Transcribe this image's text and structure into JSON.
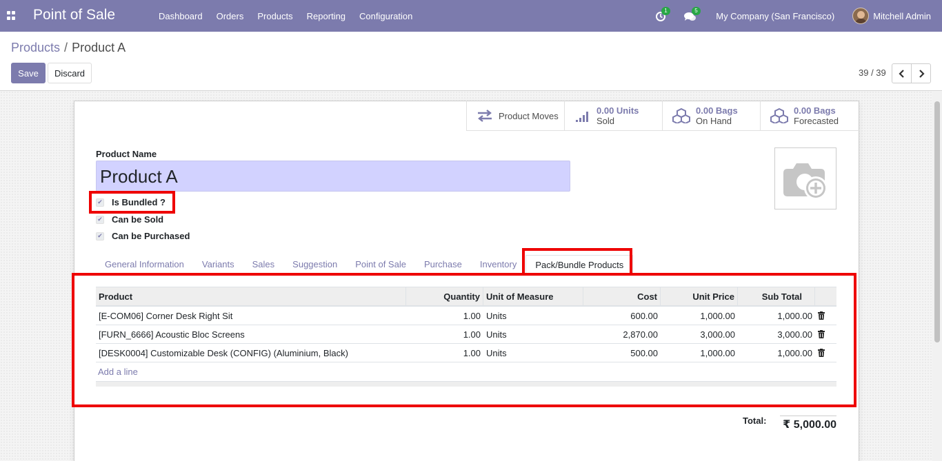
{
  "navbar": {
    "app_name": "Point of Sale",
    "menu": [
      "Dashboard",
      "Orders",
      "Products",
      "Reporting",
      "Configuration"
    ],
    "activity_badge": "1",
    "message_badge": "5",
    "company": "My Company (San Francisco)",
    "user": "Mitchell Admin",
    "bg_color": "#7c7bad"
  },
  "breadcrumb": {
    "parent": "Products",
    "separator": "/",
    "current": "Product A"
  },
  "buttons": {
    "save": "Save",
    "discard": "Discard"
  },
  "pager": {
    "value": "39 / 39"
  },
  "stats": {
    "moves": "Product Moves",
    "sold_value": "0.00 Units",
    "sold_label": "Sold",
    "onhand_value": "0.00 Bags",
    "onhand_label": "On Hand",
    "forecast_value": "0.00 Bags",
    "forecast_label": "Forecasted"
  },
  "form": {
    "name_label": "Product Name",
    "name_value": "Product A",
    "checkboxes": [
      {
        "label": "Is Bundled ?",
        "checked": true
      },
      {
        "label": "Can be Sold",
        "checked": true
      },
      {
        "label": "Can be Purchased",
        "checked": true
      }
    ]
  },
  "tabs": [
    "General Information",
    "Variants",
    "Sales",
    "Suggestion",
    "Point of Sale",
    "Purchase",
    "Inventory",
    "Pack/Bundle Products"
  ],
  "active_tab": "Pack/Bundle Products",
  "table": {
    "headers": {
      "product": "Product",
      "quantity": "Quantity",
      "uom": "Unit of Measure",
      "cost": "Cost",
      "unit_price": "Unit Price",
      "subtotal": "Sub Total"
    },
    "rows": [
      {
        "product": "[E-COM06] Corner Desk Right Sit",
        "quantity": "1.00",
        "uom": "Units",
        "cost": "600.00",
        "unit_price": "1,000.00",
        "subtotal": "1,000.00"
      },
      {
        "product": "[FURN_6666] Acoustic Bloc Screens",
        "quantity": "1.00",
        "uom": "Units",
        "cost": "2,870.00",
        "unit_price": "3,000.00",
        "subtotal": "3,000.00"
      },
      {
        "product": "[DESK0004] Customizable Desk (CONFIG) (Aluminium, Black)",
        "quantity": "1.00",
        "uom": "Units",
        "cost": "500.00",
        "unit_price": "1,000.00",
        "subtotal": "1,000.00"
      }
    ],
    "add_line": "Add a line"
  },
  "total": {
    "label": "Total:",
    "value": "₹ 5,000.00"
  },
  "colors": {
    "accent": "#7c7bad",
    "highlight": "#ee0000",
    "name_field_bg": "#d2d2ff"
  }
}
